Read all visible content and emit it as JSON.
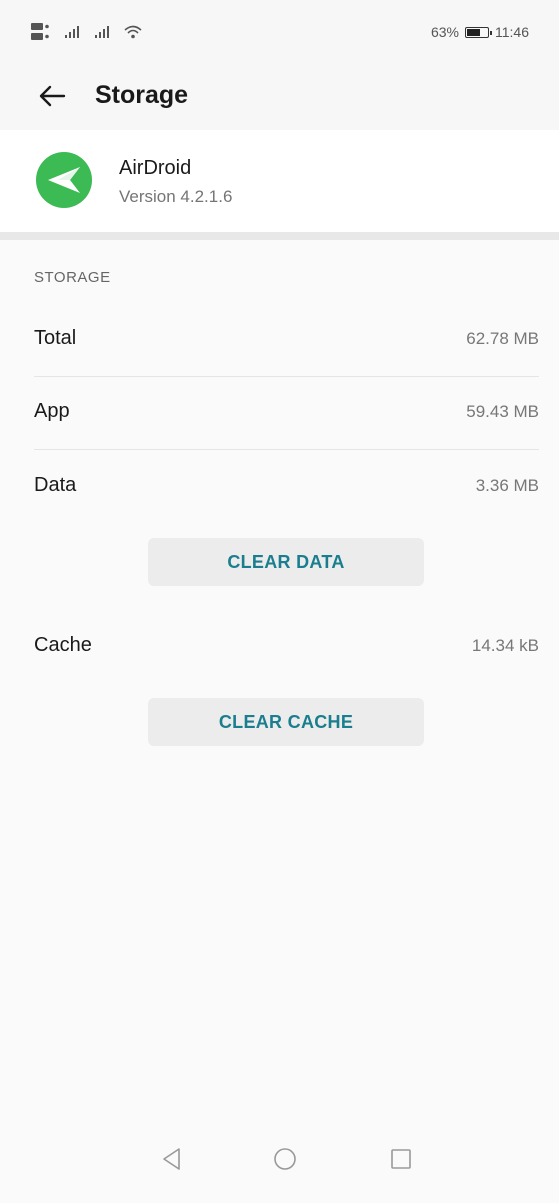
{
  "status_bar": {
    "battery_percent": "63%",
    "battery_level": 0.63,
    "time": "11:46",
    "icons": [
      "sim-icon",
      "signal-icon",
      "signal-icon",
      "wifi-icon",
      "battery-icon"
    ]
  },
  "header": {
    "title": "Storage",
    "back_icon": "back-arrow-icon"
  },
  "app": {
    "name": "AirDroid",
    "version": "Version 4.2.1.6",
    "icon": "airdroid-logo-icon",
    "icon_color": "#3cba54"
  },
  "storage": {
    "section_title": "STORAGE",
    "rows": [
      {
        "label": "Total",
        "value": "62.78 MB"
      },
      {
        "label": "App",
        "value": "59.43 MB"
      },
      {
        "label": "Data",
        "value": "3.36 MB"
      }
    ],
    "clear_data_label": "CLEAR DATA",
    "cache": {
      "label": "Cache",
      "value": "14.34 kB"
    },
    "clear_cache_label": "CLEAR CACHE"
  },
  "nav": {
    "back_icon": "nav-back-icon",
    "home_icon": "nav-home-icon",
    "recents_icon": "nav-recents-icon"
  },
  "colors": {
    "accent": "#1a7e8e",
    "button_bg": "#ececec"
  }
}
